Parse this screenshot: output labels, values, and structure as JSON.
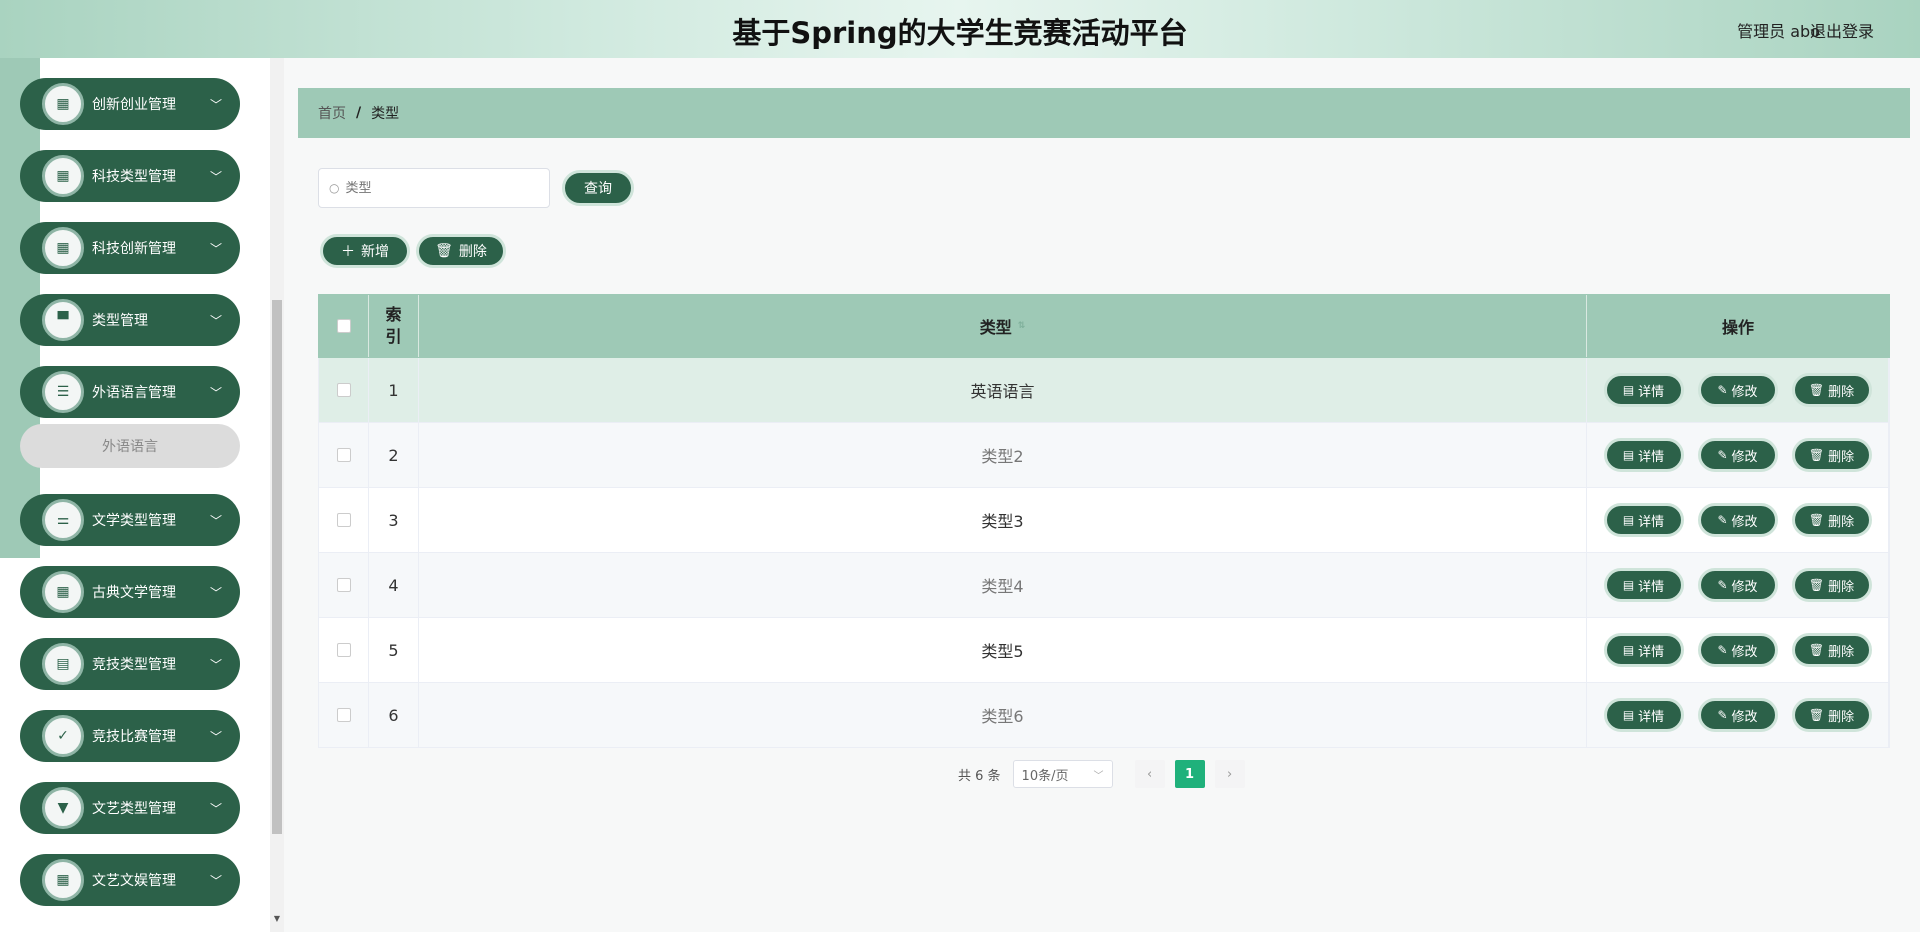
{
  "header": {
    "title": "基于Spring的大学生竞赛活动平台",
    "user": "管理员 abo",
    "logout": "退出登录"
  },
  "sidebar": {
    "items": [
      {
        "label": "创新创业管理",
        "icon": "grid-icon"
      },
      {
        "label": "科技类型管理",
        "icon": "grid-icon"
      },
      {
        "label": "科技创新管理",
        "icon": "grid-icon"
      },
      {
        "label": "类型管理",
        "icon": "stamp-icon"
      },
      {
        "label": "外语语言管理",
        "icon": "list-icon"
      },
      {
        "label": "文学类型管理",
        "icon": "sliders-icon"
      },
      {
        "label": "古典文学管理",
        "icon": "grid-icon"
      },
      {
        "label": "竞技类型管理",
        "icon": "clipboard-icon"
      },
      {
        "label": "竞技比赛管理",
        "icon": "clipboard-check-icon"
      },
      {
        "label": "文艺类型管理",
        "icon": "brush-icon"
      },
      {
        "label": "文艺文娱管理",
        "icon": "grid-icon"
      }
    ],
    "submenu": "外语语言"
  },
  "breadcrumb": {
    "home": "首页",
    "sep": "/",
    "current": "类型"
  },
  "search": {
    "placeholder": "类型",
    "button": "查询"
  },
  "toolbar": {
    "add": "新增",
    "delete": "删除"
  },
  "table": {
    "headers": {
      "index": "索引",
      "type": "类型",
      "ops": "操作"
    },
    "rows": [
      {
        "index": "1",
        "type": "英语语言"
      },
      {
        "index": "2",
        "type": "类型2"
      },
      {
        "index": "3",
        "type": "类型3"
      },
      {
        "index": "4",
        "type": "类型4"
      },
      {
        "index": "5",
        "type": "类型5"
      },
      {
        "index": "6",
        "type": "类型6"
      }
    ],
    "ops": {
      "detail": "详情",
      "edit": "修改",
      "delete": "删除"
    }
  },
  "pagination": {
    "total": "共 6 条",
    "page_size": "10条/页",
    "current": "1"
  },
  "colors": {
    "primary": "#2c6149",
    "accent": "#9ec9b6",
    "page_active": "#1fb17b"
  }
}
